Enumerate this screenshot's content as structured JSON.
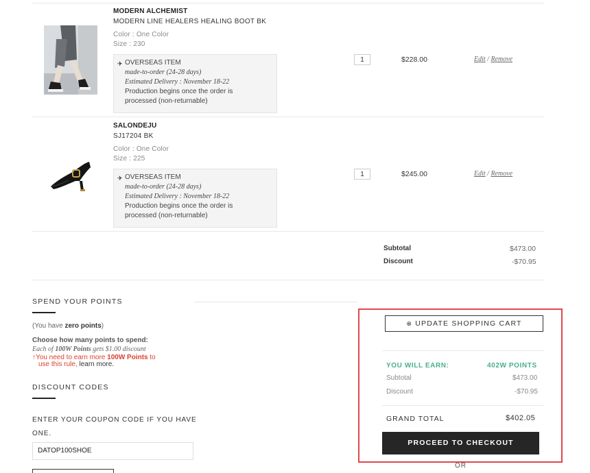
{
  "items": [
    {
      "brand": "MODERN ALCHEMIST",
      "name": "MODERN LINE HEALERS HEALING BOOT BK",
      "color": "Color : One Color",
      "size": "Size : 230",
      "note_title": "OVERSEAS ITEM",
      "note_made": "made-to-order (24-28 days)",
      "note_delivery": "Estimated Delivery : November 18-22",
      "note_prod1": "Production begins once the order is",
      "note_prod2": "processed (non-returnable)",
      "qty": "1",
      "price": "$228.00",
      "edit": "Edit",
      "sep": "/",
      "remove": "Remove"
    },
    {
      "brand": "SALONDEJU",
      "name": "SJ17204 BK",
      "color": "Color : One Color",
      "size": "Size : 225",
      "note_title": "OVERSEAS ITEM",
      "note_made": "made-to-order (24-28 days)",
      "note_delivery": "Estimated Delivery : November 18-22",
      "note_prod1": "Production begins once the order is",
      "note_prod2": "processed (non-returnable)",
      "qty": "1",
      "price": "$245.00",
      "edit": "Edit",
      "sep": "/",
      "remove": "Remove"
    }
  ],
  "totals_top": {
    "subtotal_label": "Subtotal",
    "subtotal_value": "$473.00",
    "discount_label": "Discount",
    "discount_value": "-$70.95"
  },
  "points": {
    "heading": "SPEND YOUR POINTS",
    "have_prefix": "(You have ",
    "have_bold": "zero points",
    "have_suffix": ")",
    "choose": "Choose how many points to spend:",
    "each_prefix": "Each of ",
    "each_bold": "100W Points",
    "each_suffix": " gets $1.00 discount",
    "warn_prefix": "You need to earn more ",
    "warn_bold": "100W Points",
    "warn_suffix": " to",
    "warn_line2": "use this rule,",
    "learn_more": "learn more."
  },
  "discount": {
    "heading": "DISCOUNT CODES",
    "prompt1": "ENTER YOUR COUPON CODE IF YOU HAVE",
    "prompt2": "ONE.",
    "code_value": "DATOP100SHOE"
  },
  "summary": {
    "update_label": "UPDATE SHOPPING CART",
    "earn_label": "YOU WILL EARN:",
    "earn_value": "402W POINTS",
    "subtotal_label": "Subtotal",
    "subtotal_value": "$473.00",
    "discount_label": "Discount",
    "discount_value": "-$70.95",
    "grand_label": "GRAND TOTAL",
    "grand_value": "$402.05",
    "checkout_label": "PROCEED TO CHECKOUT",
    "or_label": "OR"
  },
  "colors": {
    "accent_green": "#4aae8c",
    "highlight_red": "#e0474c",
    "warn_red": "#d9412f",
    "button_dark": "#262626"
  }
}
